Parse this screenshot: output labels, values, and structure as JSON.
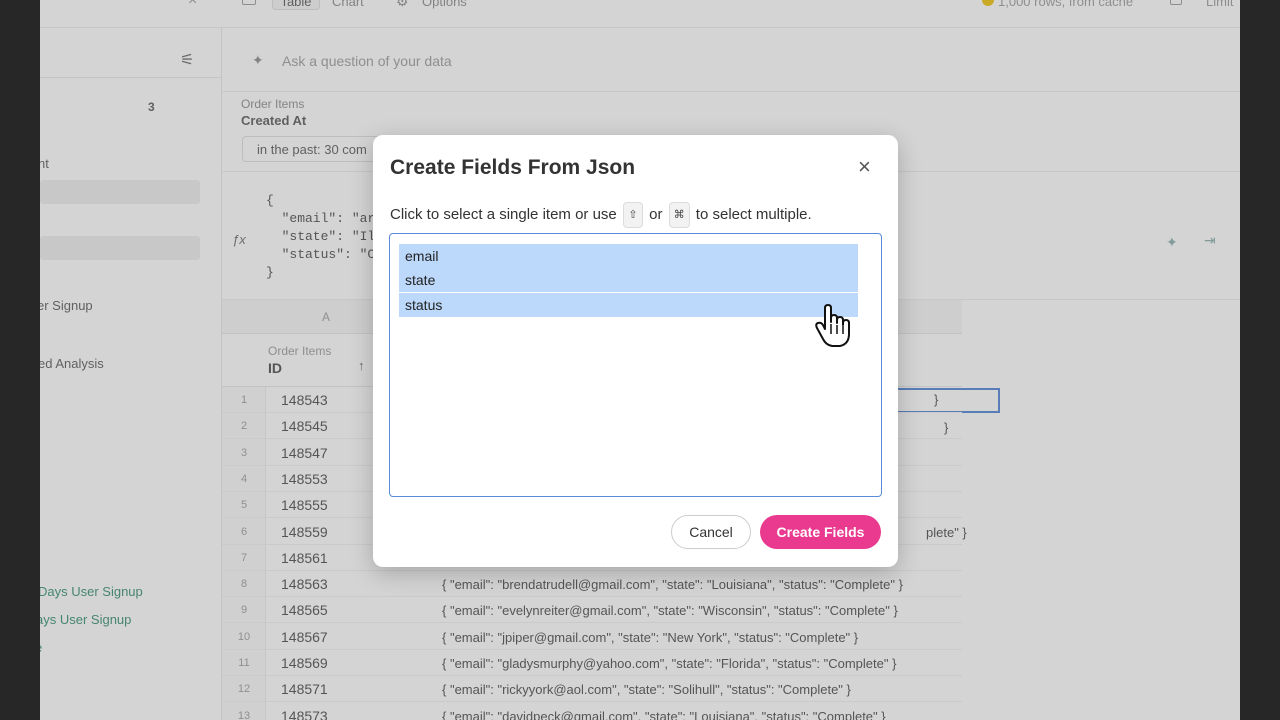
{
  "topbar": {
    "tab_table": "Table",
    "tab_chart": "Chart",
    "options": "Options",
    "rows_status": "1,000 rows, from cache",
    "limit": "Limit"
  },
  "sidebar": {
    "count": "3",
    "item_partial": "nt",
    "links": [
      {
        "label": "er Signup"
      },
      {
        "label": "ed Analysis"
      },
      {
        "label": "Days User Signup"
      },
      {
        "label": "ays User Signup"
      },
      {
        "label": "e"
      }
    ]
  },
  "ask": {
    "placeholder": "Ask a question of your data"
  },
  "filter": {
    "group": "Order Items",
    "field": "Created At",
    "value": "in the past: 30 com"
  },
  "formula": {
    "lines": [
      "{",
      "  \"email\": \"ar",
      "  \"state\": \"Il",
      "  \"status\": \"C",
      "}"
    ]
  },
  "table": {
    "column_letter": "A",
    "header_group": "Order Items",
    "header_name": "ID",
    "rows": [
      {
        "index": "1",
        "id": "148543",
        "json": ""
      },
      {
        "index": "2",
        "id": "148545",
        "json": ""
      },
      {
        "index": "3",
        "id": "148547",
        "json": ""
      },
      {
        "index": "4",
        "id": "148553",
        "json": ""
      },
      {
        "index": "5",
        "id": "148555",
        "json": ""
      },
      {
        "index": "6",
        "id": "148559",
        "json": ""
      },
      {
        "index": "7",
        "id": "148561",
        "json": ""
      },
      {
        "index": "8",
        "id": "148563",
        "json": "{ \"email\": \"brendatrudell@gmail.com\", \"state\": \"Louisiana\", \"status\": \"Complete\" }"
      },
      {
        "index": "9",
        "id": "148565",
        "json": "{ \"email\": \"evelynreiter@gmail.com\", \"state\": \"Wisconsin\", \"status\": \"Complete\" }"
      },
      {
        "index": "10",
        "id": "148567",
        "json": "{ \"email\": \"jpiper@gmail.com\", \"state\": \"New York\", \"status\": \"Complete\" }"
      },
      {
        "index": "11",
        "id": "148569",
        "json": "{ \"email\": \"gladysmurphy@yahoo.com\", \"state\": \"Florida\", \"status\": \"Complete\" }"
      },
      {
        "index": "12",
        "id": "148571",
        "json": "{ \"email\": \"rickyyork@aol.com\", \"state\": \"Solihull\", \"status\": \"Complete\" }"
      },
      {
        "index": "13",
        "id": "148573",
        "json": "{ \"email\": \"davidpeck@gmail.com\", \"state\": \"Louisiana\", \"status\": \"Complete\" }"
      }
    ],
    "partial_right": [
      "}",
      "}",
      "plete\" }"
    ]
  },
  "modal": {
    "title": "Create Fields From Json",
    "instruction_pre": "Click to select a single item or use",
    "key_shift": "⇧",
    "instruction_or": "or",
    "key_cmd": "⌘",
    "instruction_post": "to select multiple.",
    "options": [
      {
        "label": "email",
        "selected": true
      },
      {
        "label": "state",
        "selected": true
      },
      {
        "label": "status",
        "selected": true
      }
    ],
    "cancel_label": "Cancel",
    "create_label": "Create Fields"
  },
  "colors": {
    "accent": "#ea3a8f",
    "selection": "#bcd8fb",
    "focus_border": "#5a8bd8",
    "sidebar_link": "#2e8b6e"
  },
  "icons": {
    "close": "close-icon",
    "filter": "filter-settings-icon",
    "sparkle": "sparkle-icon",
    "formula": "fx-icon",
    "sort": "sort-up-icon",
    "cursor": "hand-pointer-icon"
  }
}
